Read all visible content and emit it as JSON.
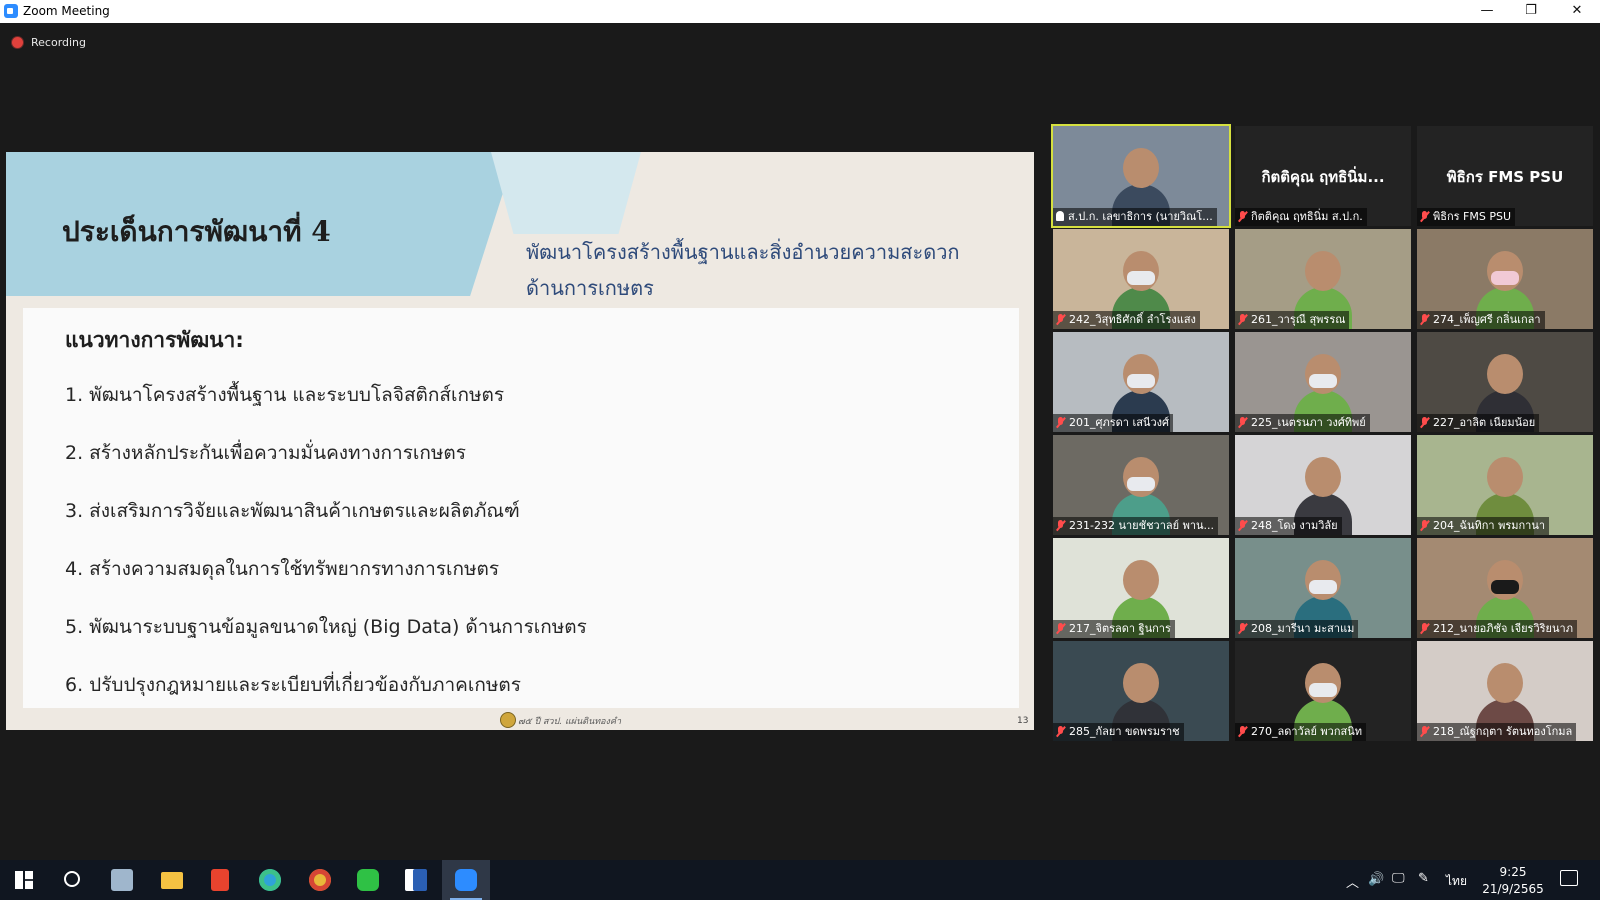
{
  "window": {
    "title": "Zoom Meeting",
    "minimize": "—",
    "restore": "❐",
    "close": "✕"
  },
  "recording": {
    "label": "Recording",
    "color": "#e0413c"
  },
  "slide": {
    "heading": "ประเด็นการพัฒนาที่ 4",
    "subtitle": "พัฒนาโครงสร้างพื้นฐานและสิ่งอำนวยความสะดวกด้านการเกษตร",
    "list_heading": "แนวทางการพัฒนา:",
    "items": [
      "1. พัฒนาโครงสร้างพื้นฐาน และระบบโลจิสติกส์เกษตร",
      "2. สร้างหลักประกันเพื่อความมั่นคงทางการเกษตร",
      "3. ส่งเสริมการวิจัยและพัฒนาสินค้าเกษตรและผลิตภัณฑ์",
      "4. สร้างความสมดุลในการใช้ทรัพยากรทางการเกษตร",
      "5. พัฒนาระบบฐานข้อมูลขนาดใหญ่ (Big Data) ด้านการเกษตร",
      "6. ปรับปรุงกฎหมายและระเบียบที่เกี่ยวข้องกับภาคเกษตร"
    ],
    "footer": "๗๕ ปี สวป. แผ่นดินทองคำ",
    "page_number": "13",
    "colors": {
      "band": "#a9d2e0",
      "subtitle": "#2e4a7a",
      "background": "#eee9e2"
    }
  },
  "gallery": {
    "active_border_color": "#d5e03f",
    "participants": [
      {
        "name": "ส.ป.ก. เลขาธิการ (นายวิณโ...",
        "big_name": "",
        "pinned": true,
        "muted": false,
        "active": true,
        "bg": "#7d8a99",
        "shirt": "#3b4a5e",
        "mask": ""
      },
      {
        "name": "กิตติคุณ ฤทธินิ่ม ส.ป.ก.",
        "big_name": "กิตติคุณ ฤทธินิ่ม...",
        "pinned": false,
        "muted": true,
        "active": false,
        "bg": "#232323",
        "shirt": "",
        "mask": ""
      },
      {
        "name": "พิธิกร FMS PSU",
        "big_name": "พิธิกร FMS PSU",
        "pinned": false,
        "muted": true,
        "active": false,
        "bg": "#232323",
        "shirt": "",
        "mask": ""
      },
      {
        "name": "242_วิสุทธิศักดิ์ ลำโรงแสง",
        "big_name": "",
        "pinned": false,
        "muted": true,
        "active": false,
        "bg": "#c9b59a",
        "shirt": "#4f8a4a",
        "mask": "light"
      },
      {
        "name": "261_วารุณี สุพรรณ",
        "big_name": "",
        "pinned": false,
        "muted": true,
        "active": false,
        "bg": "#a59d86",
        "shirt": "#6fae4c",
        "mask": ""
      },
      {
        "name": "274_เพ็ญศรี กลิ่นเกลา",
        "big_name": "",
        "pinned": false,
        "muted": true,
        "active": false,
        "bg": "#8b7a66",
        "shirt": "#6fae4c",
        "mask": "pink"
      },
      {
        "name": "201_ศุภรดา เสนีวงศ์",
        "big_name": "",
        "pinned": false,
        "muted": true,
        "active": false,
        "bg": "#b7bcc1",
        "shirt": "#2b3b4f",
        "mask": "light"
      },
      {
        "name": "225_เนตรนภา วงศ์ทิพย์",
        "big_name": "",
        "pinned": false,
        "muted": true,
        "active": false,
        "bg": "#9a9591",
        "shirt": "#6fae4c",
        "mask": "light"
      },
      {
        "name": "227_อาลิต เนียมน้อย",
        "big_name": "",
        "pinned": false,
        "muted": true,
        "active": false,
        "bg": "#4e4a44",
        "shirt": "#2f2f35",
        "mask": ""
      },
      {
        "name": "231-232 นายชัชวาลย์ พาน...",
        "big_name": "",
        "pinned": false,
        "muted": true,
        "active": false,
        "bg": "#6d6a63",
        "shirt": "#4d9e8a",
        "mask": "light"
      },
      {
        "name": "248_โดง งามวิลัย",
        "big_name": "",
        "pinned": false,
        "muted": true,
        "active": false,
        "bg": "#d5d4d6",
        "shirt": "#3a3a40",
        "mask": ""
      },
      {
        "name": "204_ฉันทิกา พรมกานา",
        "big_name": "",
        "pinned": false,
        "muted": true,
        "active": false,
        "bg": "#a8b58f",
        "shirt": "#6f8d3e",
        "mask": ""
      },
      {
        "name": "217_จิตรลดา ฐินการ",
        "big_name": "",
        "pinned": false,
        "muted": true,
        "active": false,
        "bg": "#dfe2d8",
        "shirt": "#6fae4c",
        "mask": ""
      },
      {
        "name": "208_มารีนา มะสาแม",
        "big_name": "",
        "pinned": false,
        "muted": true,
        "active": false,
        "bg": "#788f8b",
        "shirt": "#2a6e7e",
        "mask": "light"
      },
      {
        "name": "212_นายอภิชัจ เจียรวิริยนาภ",
        "big_name": "",
        "pinned": false,
        "muted": true,
        "active": false,
        "bg": "#a48a72",
        "shirt": "#6fae4c",
        "mask": "dark"
      },
      {
        "name": "285_กัลยา ขดพรมราช",
        "big_name": "",
        "pinned": false,
        "muted": true,
        "active": false,
        "bg": "#3a4a52",
        "shirt": "#303238",
        "mask": ""
      },
      {
        "name": "270_ลดาวัลย์ พวกสนิท",
        "big_name": "",
        "pinned": false,
        "muted": true,
        "active": false,
        "bg": "#232323",
        "shirt": "#6fae4c",
        "mask": "light"
      },
      {
        "name": "218_ณัฐกฤตา รัตนทองโกมล",
        "big_name": "",
        "pinned": false,
        "muted": true,
        "active": false,
        "bg": "#d4ccc7",
        "shirt": "#6d4a46",
        "mask": ""
      }
    ]
  },
  "taskbar": {
    "apps": [
      {
        "icon": "windows-start-icon",
        "active": false,
        "color": "#ffffff"
      },
      {
        "icon": "search-icon",
        "active": false,
        "color": "#ffffff"
      },
      {
        "icon": "file-explorer-alt-icon",
        "active": false,
        "color": "#9fb6cc"
      },
      {
        "icon": "folder-icon",
        "active": false,
        "color": "#f5c242"
      },
      {
        "icon": "office-icon",
        "active": false,
        "color": "#e8432e"
      },
      {
        "icon": "edge-icon",
        "active": false,
        "color": "#2fa3d8"
      },
      {
        "icon": "chrome-icon",
        "active": false,
        "color": "#e8b73a"
      },
      {
        "icon": "line-icon",
        "active": false,
        "color": "#2fc145"
      },
      {
        "icon": "word-icon",
        "active": false,
        "color": "#2b5fb3"
      },
      {
        "icon": "zoom-icon",
        "active": true,
        "color": "#2d8cff"
      }
    ],
    "language": "ไทย",
    "time": "9:25",
    "date": "21/9/2565"
  }
}
